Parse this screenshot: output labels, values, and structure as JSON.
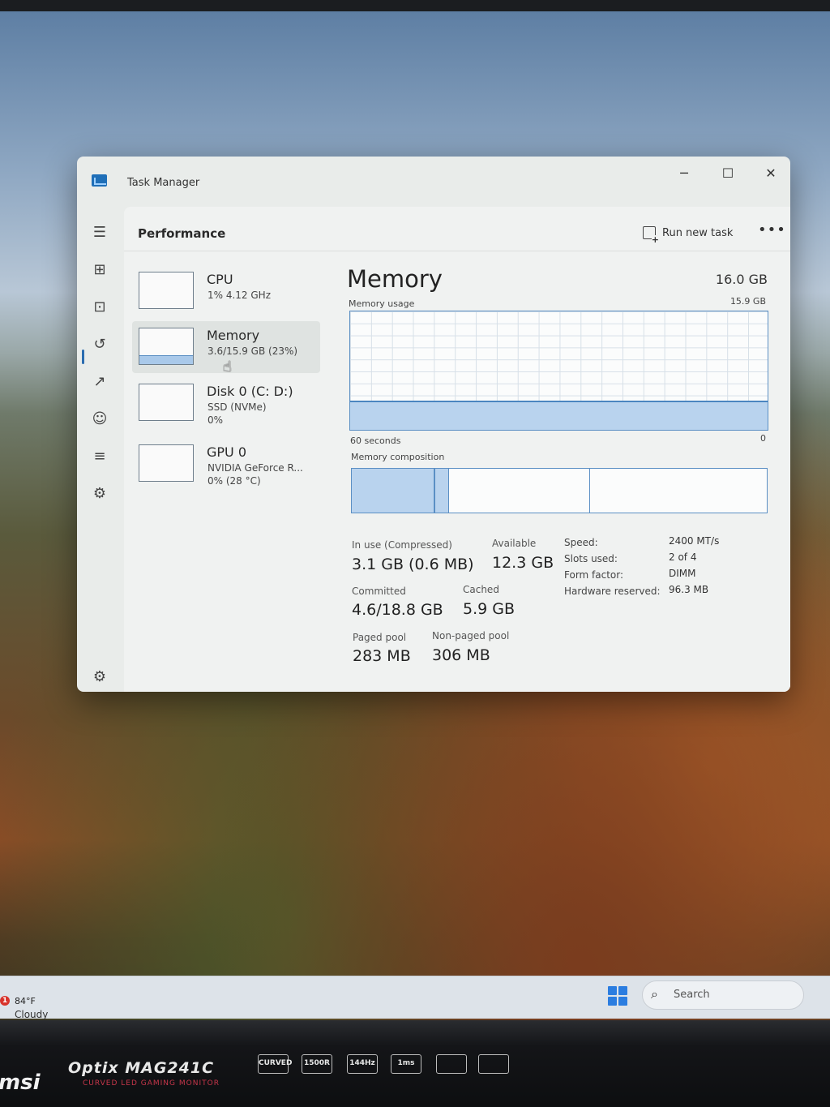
{
  "window": {
    "title": "Task Manager",
    "controls": {
      "minimize": "─",
      "maximize": "☐",
      "close": "✕"
    }
  },
  "header": {
    "page_title": "Performance",
    "run_task_label": "Run new task",
    "more_label": "•••"
  },
  "nav": {
    "items": [
      {
        "name": "hamburger-menu-icon",
        "glyph": "☰"
      },
      {
        "name": "processes-icon",
        "glyph": "⊞"
      },
      {
        "name": "performance-icon",
        "glyph": "⊡"
      },
      {
        "name": "app-history-icon",
        "glyph": "↺"
      },
      {
        "name": "startup-apps-icon",
        "glyph": "↗"
      },
      {
        "name": "users-icon",
        "glyph": "☺"
      },
      {
        "name": "details-icon",
        "glyph": "≡"
      },
      {
        "name": "services-icon",
        "glyph": "⚙"
      }
    ],
    "settings_glyph": "⚙"
  },
  "devices": [
    {
      "name": "CPU",
      "line1": "1% 4.12 GHz",
      "line2": ""
    },
    {
      "name": "Memory",
      "line1": "3.6/15.9 GB (23%)",
      "line2": ""
    },
    {
      "name": "Disk 0 (C: D:)",
      "line1": "SSD (NVMe)",
      "line2": "0%"
    },
    {
      "name": "GPU 0",
      "line1": "NVIDIA GeForce R...",
      "line2": "0% (28 °C)"
    }
  ],
  "detail": {
    "title": "Memory",
    "total": "16.0 GB",
    "usage_label": "Memory usage",
    "usage_max": "15.9 GB",
    "usage_fraction": 0.23,
    "x_left": "60 seconds",
    "x_right": "0",
    "composition_label": "Memory composition",
    "composition_fractions": {
      "in_use": 0.2,
      "modified": 0.035,
      "standby": 0.34,
      "free": 0.425
    },
    "stats": {
      "in_use_label": "In use (Compressed)",
      "in_use_value": "3.1 GB (0.6 MB)",
      "available_label": "Available",
      "available_value": "12.3 GB",
      "committed_label": "Committed",
      "committed_value": "4.6/18.8 GB",
      "cached_label": "Cached",
      "cached_value": "5.9 GB",
      "paged_label": "Paged pool",
      "paged_value": "283 MB",
      "nonpaged_label": "Non-paged pool",
      "nonpaged_value": "306 MB"
    },
    "specs": [
      {
        "label": "Speed:",
        "value": "2400 MT/s"
      },
      {
        "label": "Slots used:",
        "value": "2 of 4"
      },
      {
        "label": "Form factor:",
        "value": "DIMM"
      },
      {
        "label": "Hardware reserved:",
        "value": "96.3 MB"
      }
    ]
  },
  "taskbar": {
    "search_placeholder": "Search",
    "weather_badge": "1",
    "weather_temp": "84°F",
    "weather_condition": "Cloudy"
  },
  "monitor": {
    "brand": "msi",
    "model": "Optix MAG241C",
    "model_sub": "CURVED LED GAMING MONITOR",
    "features": [
      "CURVED",
      "1500R",
      "144Hz",
      "1ms",
      "",
      ""
    ]
  },
  "colors": {
    "accent": "#2b6cb0",
    "graph_fill": "#b9d3ee",
    "graph_line": "#4b86c0"
  }
}
